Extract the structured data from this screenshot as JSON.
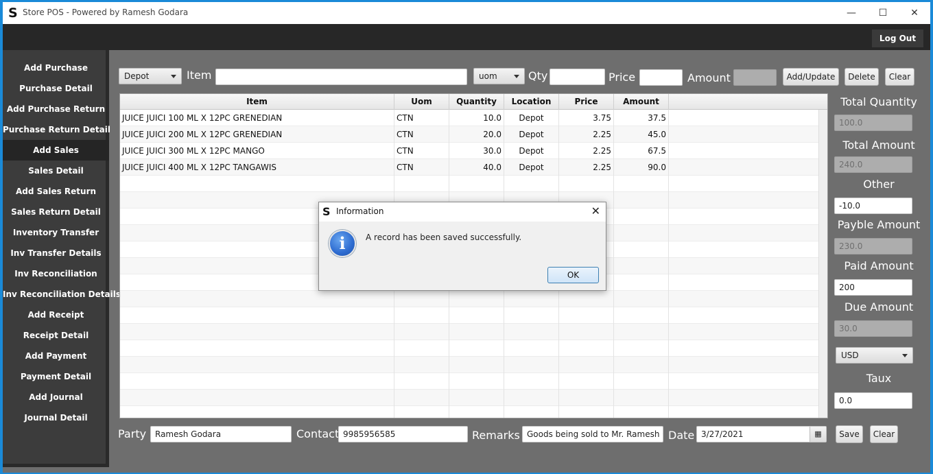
{
  "window": {
    "title": "Store POS - Powered by Ramesh Godara",
    "logo": "S",
    "minimize": "—",
    "maximize": "☐",
    "close": "✕"
  },
  "topbar": {
    "logout_label": "Log Out"
  },
  "sidebar": {
    "items": [
      {
        "label": "Add Purchase"
      },
      {
        "label": "Purchase Detail"
      },
      {
        "label": "Add Purchase Return"
      },
      {
        "label": "Purchase Return Detail"
      },
      {
        "label": "Add Sales",
        "active": true
      },
      {
        "label": "Sales Detail"
      },
      {
        "label": "Add Sales Return"
      },
      {
        "label": "Sales Return Detail"
      },
      {
        "label": "Inventory Transfer"
      },
      {
        "label": "Inv Transfer Details"
      },
      {
        "label": "Inv Reconciliation"
      },
      {
        "label": "Inv Reconciliation Details"
      },
      {
        "label": "Add Receipt"
      },
      {
        "label": "Receipt Detail"
      },
      {
        "label": "Add Payment"
      },
      {
        "label": "Payment Detail"
      },
      {
        "label": "Add Journal"
      },
      {
        "label": "Journal Detail"
      }
    ]
  },
  "entry": {
    "location_value": "Depot",
    "item_label": "Item",
    "item_value": "",
    "uom_value": "uom",
    "qty_label": "Qty",
    "qty_value": "",
    "price_label": "Price",
    "price_value": "",
    "amount_label": "Amount",
    "amount_value": "",
    "add_update_label": "Add/Update",
    "delete_label": "Delete",
    "clear_label": "Clear"
  },
  "table": {
    "columns": [
      "Item",
      "Uom",
      "Quantity",
      "Location",
      "Price",
      "Amount"
    ],
    "rows": [
      {
        "item": "JUICE JUICI 100 ML X 12PC GRENEDIAN",
        "uom": "CTN",
        "quantity": "10.0",
        "location": "Depot",
        "price": "3.75",
        "amount": "37.5"
      },
      {
        "item": "JUICE JUICI 200 ML X 12PC GRENEDIAN",
        "uom": "CTN",
        "quantity": "20.0",
        "location": "Depot",
        "price": "2.25",
        "amount": "45.0"
      },
      {
        "item": "JUICE JUICI 300 ML X 12PC MANGO",
        "uom": "CTN",
        "quantity": "30.0",
        "location": "Depot",
        "price": "2.25",
        "amount": "67.5"
      },
      {
        "item": "JUICE JUICI 400 ML X 12PC TANGAWIS",
        "uom": "CTN",
        "quantity": "40.0",
        "location": "Depot",
        "price": "2.25",
        "amount": "90.0"
      }
    ]
  },
  "totals": {
    "total_quantity_label": "Total Quantity",
    "total_quantity_value": "100.0",
    "total_amount_label": "Total Amount",
    "total_amount_value": "240.0",
    "other_label": "Other",
    "other_value": "-10.0",
    "payable_label": "Payble Amount",
    "payable_value": "230.0",
    "paid_label": "Paid Amount",
    "paid_value": "200",
    "due_label": "Due Amount",
    "due_value": "30.0",
    "currency_value": "USD",
    "taux_label": "Taux",
    "taux_value": "0.0"
  },
  "footer": {
    "party_label": "Party",
    "party_value": "Ramesh Godara",
    "contact_label": "Contact",
    "contact_value": "9985956585",
    "remarks_label": "Remarks",
    "remarks_value": "Goods being sold to Mr. Ramesh Go",
    "date_label": "Date",
    "date_value": "3/27/2021",
    "save_label": "Save",
    "clear_label": "Clear"
  },
  "dialog": {
    "logo": "S",
    "title": "Information",
    "close": "✕",
    "icon_glyph": "i",
    "message": "A record has been saved successfully.",
    "ok_label": "OK"
  }
}
